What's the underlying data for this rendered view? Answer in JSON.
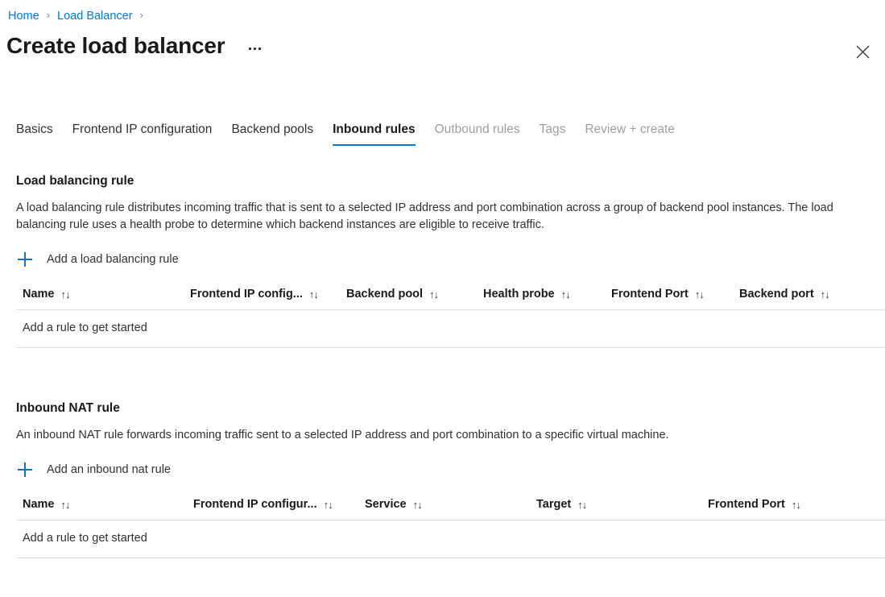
{
  "breadcrumb": {
    "items": [
      {
        "label": "Home"
      },
      {
        "label": "Load Balancer"
      }
    ],
    "separator": "›"
  },
  "header": {
    "title": "Create load balancer",
    "more_actions_label": "More actions",
    "close_label": "Close"
  },
  "tabs": [
    {
      "label": "Basics",
      "state": "enabled"
    },
    {
      "label": "Frontend IP configuration",
      "state": "enabled"
    },
    {
      "label": "Backend pools",
      "state": "enabled"
    },
    {
      "label": "Inbound rules",
      "state": "active"
    },
    {
      "label": "Outbound rules",
      "state": "disabled"
    },
    {
      "label": "Tags",
      "state": "disabled"
    },
    {
      "label": "Review + create",
      "state": "disabled"
    }
  ],
  "sort_icon": "↑↓",
  "sections": [
    {
      "title": "Load balancing rule",
      "description": "A load balancing rule distributes incoming traffic that is sent to a selected IP address and port combination across a group of backend pool instances. The load balancing rule uses a health probe to determine which backend instances are eligible to receive traffic.",
      "add_link": "Add a load balancing rule",
      "columns": [
        {
          "label": "Name"
        },
        {
          "label": "Frontend IP config..."
        },
        {
          "label": "Backend pool"
        },
        {
          "label": "Health probe"
        },
        {
          "label": "Frontend Port"
        },
        {
          "label": "Backend port"
        }
      ],
      "empty_text": "Add a rule to get started"
    },
    {
      "title": "Inbound NAT rule",
      "description": "An inbound NAT rule forwards incoming traffic sent to a selected IP address and port combination to a specific virtual machine.",
      "add_link": "Add an inbound nat rule",
      "columns": [
        {
          "label": "Name"
        },
        {
          "label": "Frontend IP configur..."
        },
        {
          "label": "Service"
        },
        {
          "label": "Target"
        },
        {
          "label": "Frontend Port"
        }
      ],
      "empty_text": "Add a rule to get started"
    }
  ],
  "colors": {
    "accent": "#0078d4",
    "text": "#323130",
    "text_strong": "#1b1a19",
    "disabled": "#a19f9d",
    "divider": "#e1dfdd"
  }
}
